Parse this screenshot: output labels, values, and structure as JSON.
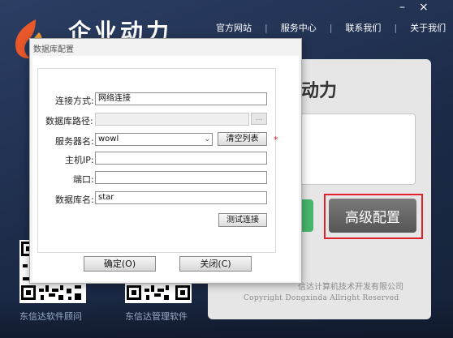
{
  "brand": {
    "name": "企业动力"
  },
  "nav": {
    "links": [
      "官方网站",
      "服务中心",
      "联系我们",
      "关于我们"
    ],
    "separator": "|"
  },
  "window": {
    "minimize": "–",
    "close": "×"
  },
  "login": {
    "title_partial": "动力",
    "advanced_config": "高级配置",
    "copyright_cn": "信达计算机技术开发有限公司",
    "copyright_en": "Copyright Dongxinda Allright Reserved"
  },
  "qr": {
    "left_label": "东信达软件顾问",
    "right_label": "东信达管理软件"
  },
  "dialog": {
    "title": "数据库配置",
    "fields": {
      "conn_type_label": "连接方式:",
      "conn_type_value": "网络连接",
      "db_path_label": "数据库路径:",
      "db_path_value": "",
      "browse": "...",
      "server_label": "服务器名:",
      "server_value": "wowl",
      "clear_list": "清空列表",
      "required": "*",
      "host_ip_label": "主机IP:",
      "host_ip_value": "",
      "port_label": "端口:",
      "port_value": "",
      "db_name_label": "数据库名:",
      "db_name_value": "star",
      "test_connection": "测试连接"
    },
    "ok": "确定(O)",
    "close": "关闭(C)"
  },
  "colors": {
    "highlight_box": "#e0202a",
    "login_green": "#47b56a",
    "flame_orange": "#e8582a"
  }
}
